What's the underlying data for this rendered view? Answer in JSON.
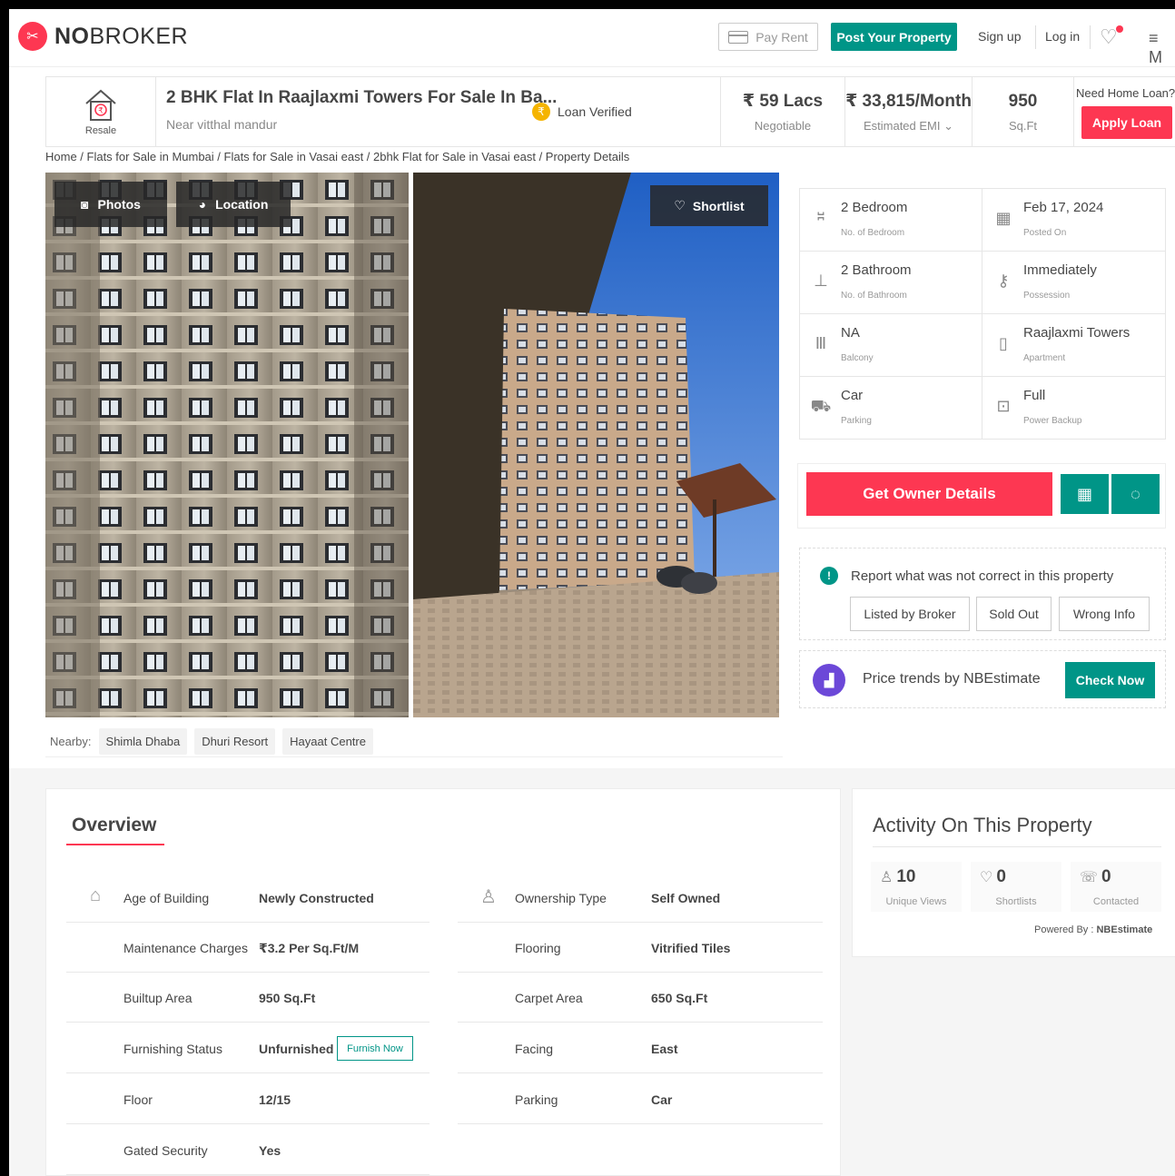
{
  "header": {
    "brand": "NOBROKER",
    "pay_rent": "Pay Rent",
    "post_property": "Post Your Property",
    "sign_up": "Sign up",
    "log_in": "Log in",
    "menu_letter": "M"
  },
  "property": {
    "type_label": "Resale",
    "title": "2 BHK Flat In Raajlaxmi Towers For Sale In Ba...",
    "subtitle": "Near vitthal mandur",
    "loan_verified": "Loan Verified",
    "price": "₹ 59 Lacs",
    "price_note": "Negotiable",
    "emi": "₹ 33,815/Month",
    "emi_note": "Estimated EMI",
    "area": "950",
    "area_unit": "Sq.Ft",
    "loan_question": "Need Home Loan?",
    "apply_loan": "Apply Loan"
  },
  "breadcrumb": "Home / Flats for Sale in Mumbai / Flats for Sale in Vasai east / 2bhk Flat for Sale in Vasai east / Property Details",
  "gallery": {
    "photos": "Photos",
    "location": "Location",
    "shortlist": "Shortlist"
  },
  "nearby": {
    "label": "Nearby:",
    "places": [
      "Shimla Dhaba",
      "Dhuri Resort",
      "Hayaat Centre"
    ]
  },
  "details": [
    {
      "value": "2 Bedroom",
      "label": "No. of Bedroom",
      "icon": "bed-icon"
    },
    {
      "value": "Feb 17, 2024",
      "label": "Posted On",
      "icon": "calendar-icon"
    },
    {
      "value": "2 Bathroom",
      "label": "No. of Bathroom",
      "icon": "bathtub-icon"
    },
    {
      "value": "Immediately",
      "label": "Possession",
      "icon": "key-icon"
    },
    {
      "value": "NA",
      "label": "Balcony",
      "icon": "balcony-icon"
    },
    {
      "value": "Raajlaxmi Towers",
      "label": "Apartment",
      "icon": "building-icon"
    },
    {
      "value": "Car",
      "label": "Parking",
      "icon": "car-icon"
    },
    {
      "value": "Full",
      "label": "Power Backup",
      "icon": "power-icon"
    }
  ],
  "actions": {
    "get_owner": "Get Owner Details",
    "report_question": "Report what was not correct in this property",
    "report_options": [
      "Listed by Broker",
      "Sold Out",
      "Wrong Info"
    ],
    "trends_text": "Price trends by NBEstimate",
    "check_now": "Check Now"
  },
  "overview": {
    "title": "Overview",
    "left": [
      {
        "key": "Age of Building",
        "value": "Newly Constructed"
      },
      {
        "key": "Maintenance Charges",
        "value": "₹3.2 Per Sq.Ft/M"
      },
      {
        "key": "Builtup Area",
        "value": "950 Sq.Ft"
      },
      {
        "key": "Furnishing Status",
        "value": "Unfurnished"
      },
      {
        "key": "Floor",
        "value": "12/15"
      },
      {
        "key": "Gated Security",
        "value": "Yes"
      }
    ],
    "right": [
      {
        "key": "Ownership Type",
        "value": "Self Owned"
      },
      {
        "key": "Flooring",
        "value": "Vitrified Tiles"
      },
      {
        "key": "Carpet Area",
        "value": "650 Sq.Ft"
      },
      {
        "key": "Facing",
        "value": "East"
      },
      {
        "key": "Parking",
        "value": "Car"
      }
    ],
    "furnish_now": "Furnish Now"
  },
  "activity": {
    "title": "Activity On This Property",
    "stats": [
      {
        "count": "10",
        "label": "Unique Views"
      },
      {
        "count": "0",
        "label": "Shortlists"
      },
      {
        "count": "0",
        "label": "Contacted"
      }
    ],
    "powered_by": "Powered By :",
    "powered_brand": "NBEstimate"
  },
  "colors": {
    "brand_red": "#fd3752",
    "teal": "#009587",
    "purple": "#6c48d8"
  }
}
